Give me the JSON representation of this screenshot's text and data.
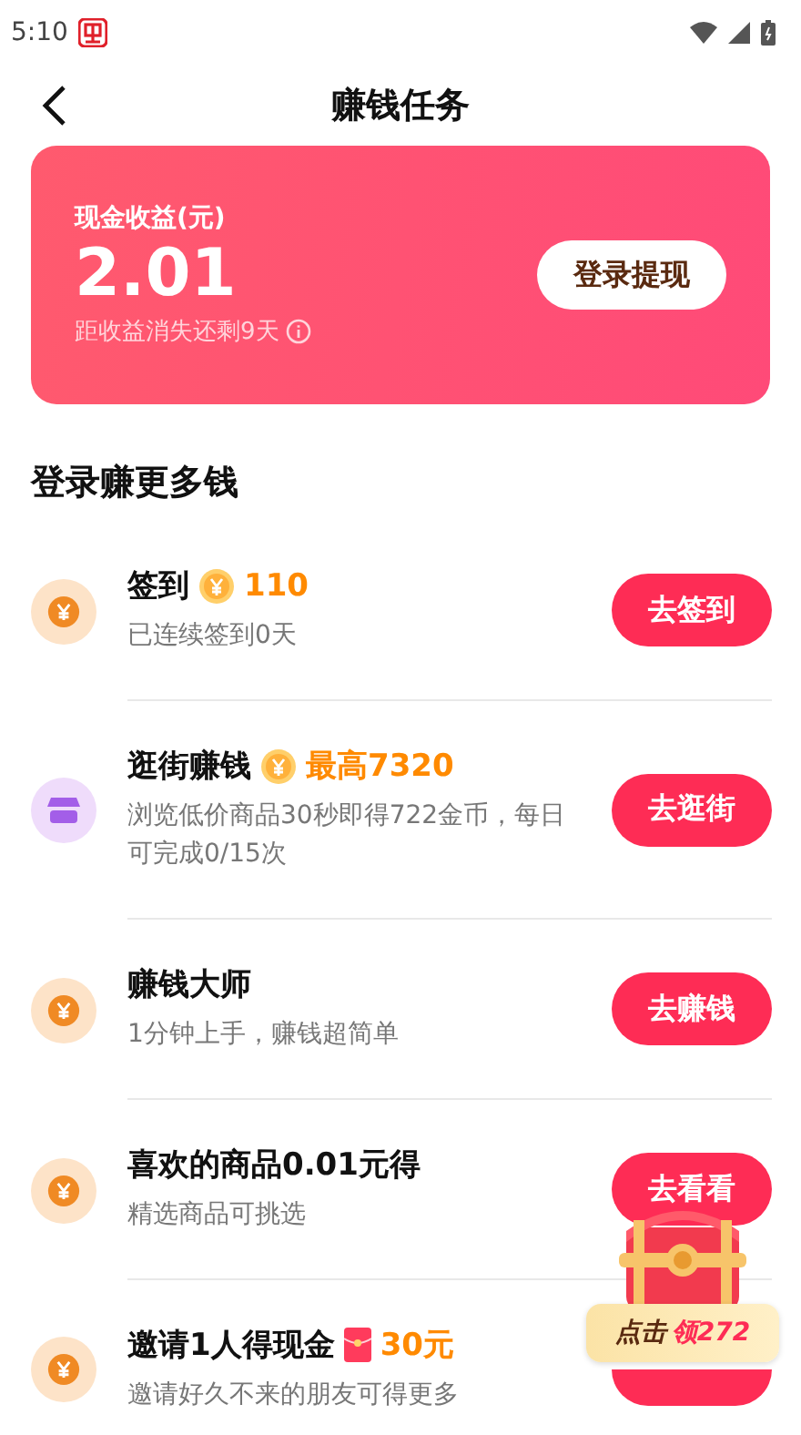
{
  "status_bar": {
    "time": "5:10"
  },
  "header": {
    "title": "赚钱任务"
  },
  "earnings_card": {
    "label": "现金收益(元)",
    "amount": "2.01",
    "expiry": "距收益消失还剩9天",
    "button": "登录提现"
  },
  "section_title": "登录赚更多钱",
  "tasks": [
    {
      "kind": "coin",
      "title": "签到",
      "reward": {
        "kind": "coin",
        "text": "110"
      },
      "subtitle": "已连续签到0天",
      "button": "去签到"
    },
    {
      "kind": "shop",
      "title": "逛街赚钱",
      "reward": {
        "kind": "coin",
        "text": "最高7320"
      },
      "subtitle": "浏览低价商品30秒即得722金币，每日可完成0/15次",
      "button": "去逛街"
    },
    {
      "kind": "coin",
      "title": "赚钱大师",
      "subtitle": "1分钟上手，赚钱超简单",
      "button": "去赚钱"
    },
    {
      "kind": "coin",
      "title": "喜欢的商品0.01元得",
      "subtitle": "精选商品可挑选",
      "button": "去看看"
    },
    {
      "kind": "coin",
      "title": "邀请1人得现金",
      "reward": {
        "kind": "envelope",
        "text": "30元"
      },
      "subtitle": "邀请好久不来的朋友可得更多"
    }
  ],
  "floating_chest": {
    "prefix": "点击",
    "amount": "领272"
  }
}
